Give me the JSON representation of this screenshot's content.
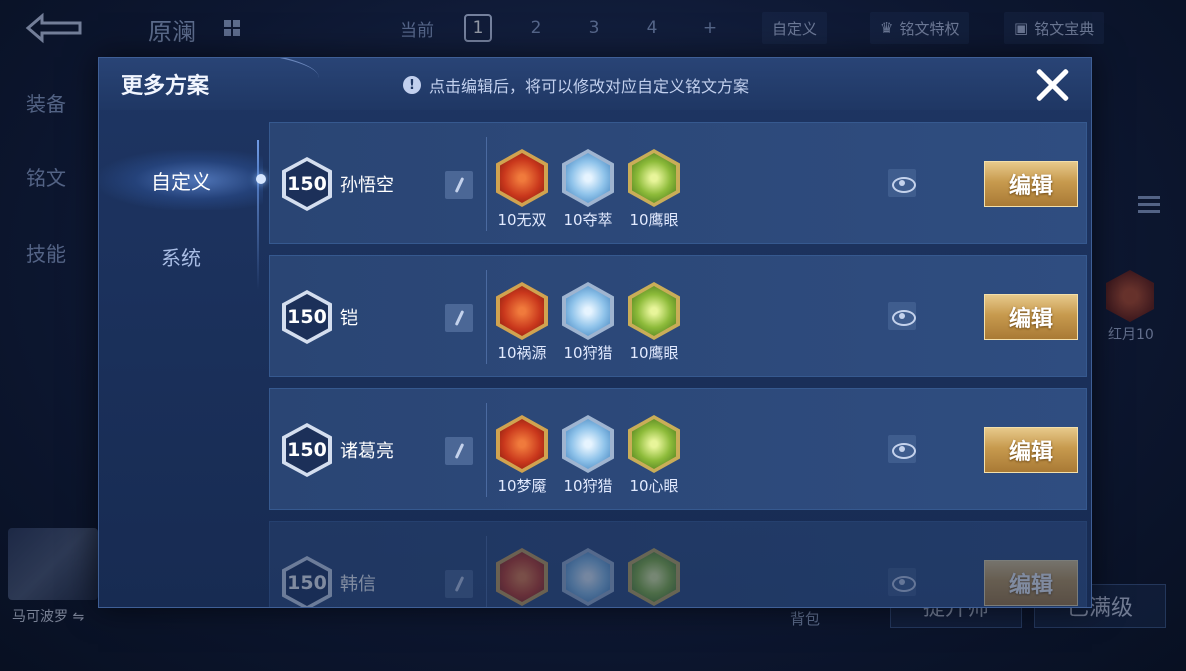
{
  "background": {
    "hero_title": "原澜",
    "current_label": "当前",
    "slots": [
      "1",
      "2",
      "3",
      "4",
      "+"
    ],
    "active_slot": 0,
    "custom_btn": "自定义",
    "privilege_btn": "铭文特权",
    "treasure_btn": "铭文宝典",
    "side_nav": [
      "装备",
      "铭文",
      "技能"
    ],
    "side_rune_label": "红月10",
    "avatar_name": "马可波罗 ⇋",
    "bag_label": "背包",
    "bottom_btns": [
      "提升师",
      "已满级"
    ]
  },
  "modal": {
    "title": "更多方案",
    "hint": "点击编辑后，将可以修改对应自定义铭文方案",
    "hint_icon": "!",
    "tabs": [
      "自定义",
      "系统"
    ],
    "active_tab": 0,
    "edit_label": "编辑",
    "rows": [
      {
        "level": "150",
        "name": "孙悟空",
        "runes": [
          {
            "color": "red",
            "label": "10无双"
          },
          {
            "color": "blue",
            "label": "10夺萃"
          },
          {
            "color": "green",
            "label": "10鹰眼"
          }
        ]
      },
      {
        "level": "150",
        "name": "铠",
        "runes": [
          {
            "color": "red",
            "label": "10祸源"
          },
          {
            "color": "blue",
            "label": "10狩猎"
          },
          {
            "color": "green",
            "label": "10鹰眼"
          }
        ]
      },
      {
        "level": "150",
        "name": "诸葛亮",
        "runes": [
          {
            "color": "red",
            "label": "10梦魇"
          },
          {
            "color": "blue",
            "label": "10狩猎"
          },
          {
            "color": "green",
            "label": "10心眼"
          }
        ]
      },
      {
        "level": "150",
        "name": "韩信",
        "runes": [
          {
            "color": "red",
            "label": ""
          },
          {
            "color": "blue",
            "label": ""
          },
          {
            "color": "green",
            "label": ""
          }
        ]
      }
    ]
  },
  "colors": {
    "accent_gold": "#c79a4e",
    "panel": "#1e3563",
    "row": "#2a4574"
  }
}
